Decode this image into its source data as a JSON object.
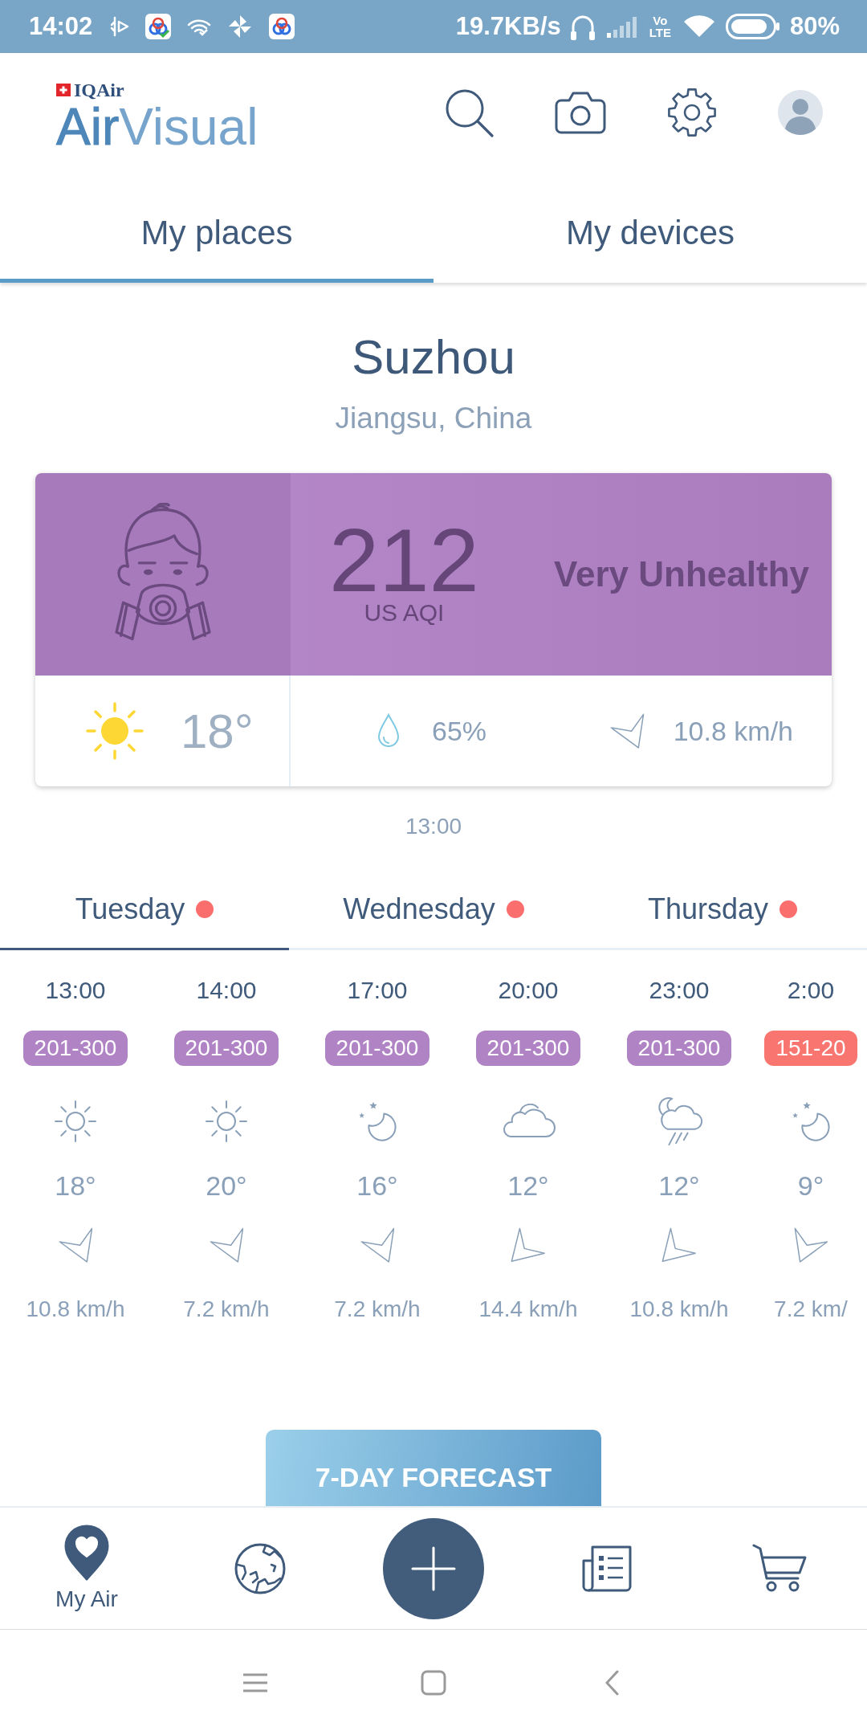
{
  "status_bar": {
    "time": "14:02",
    "network_speed": "19.7KB/s",
    "volte": {
      "top": "Vo",
      "bottom": "LTE"
    },
    "battery": "80%"
  },
  "header": {
    "brand": "IQAir",
    "logo": "**Air**Visual"
  },
  "tabs": [
    {
      "label": "My places",
      "selected": true
    },
    {
      "label": "My devices",
      "selected": false
    }
  ],
  "location": {
    "city": "Suzhou",
    "region": "Jiangsu, China"
  },
  "aqi_card": {
    "aqi": "212",
    "unit": "US AQI",
    "category": "Very Unhealthy",
    "weather": {
      "kind": "sunny"
    },
    "temperature": "18°",
    "humidity": "65%",
    "wind": {
      "kind": "sse",
      "speed": "10.8 km/h"
    }
  },
  "updated_time": "13:00",
  "day_tabs": [
    {
      "label": "Tuesday",
      "selected": true
    },
    {
      "label": "Wednesday",
      "selected": false
    },
    {
      "label": "Thursday",
      "selected": false
    }
  ],
  "hourly": [
    {
      "time": "13:00",
      "aqi_range": "201-300",
      "color": "#b083c4",
      "weather": {
        "kind": "sunny"
      },
      "temperature": "18°",
      "wind": {
        "kind": "sse",
        "speed": "10.8 km/h"
      }
    },
    {
      "time": "14:00",
      "aqi_range": "201-300",
      "color": "#b083c4",
      "weather": {
        "kind": "sunny"
      },
      "temperature": "20°",
      "wind": {
        "kind": "sse",
        "speed": "7.2 km/h"
      }
    },
    {
      "time": "17:00",
      "aqi_range": "201-300",
      "color": "#b083c4",
      "weather": {
        "kind": "clear-night"
      },
      "temperature": "16°",
      "wind": {
        "kind": "sse",
        "speed": "7.2 km/h"
      }
    },
    {
      "time": "20:00",
      "aqi_range": "201-300",
      "color": "#b083c4",
      "weather": {
        "kind": "cloudy"
      },
      "temperature": "12°",
      "wind": {
        "kind": "sw",
        "speed": "14.4 km/h"
      }
    },
    {
      "time": "23:00",
      "aqi_range": "201-300",
      "color": "#b083c4",
      "weather": {
        "kind": "rain-night"
      },
      "temperature": "12°",
      "wind": {
        "kind": "sw",
        "speed": "10.8 km/h"
      }
    },
    {
      "time": "2:00",
      "aqi_range": "151-20",
      "color": "#f8766f",
      "weather": {
        "kind": "clear-night"
      },
      "temperature": "9°",
      "wind": {
        "kind": "ssw",
        "speed": "7.2 km/"
      }
    }
  ],
  "forecast_button": "7-DAY FORECAST",
  "bottom_nav": [
    {
      "kind": "my-air",
      "label": "My Air",
      "selected": true
    },
    {
      "kind": "map",
      "selected": false
    },
    {
      "kind": "add",
      "selected": false
    },
    {
      "kind": "news",
      "selected": false
    },
    {
      "kind": "shop",
      "selected": false
    }
  ]
}
